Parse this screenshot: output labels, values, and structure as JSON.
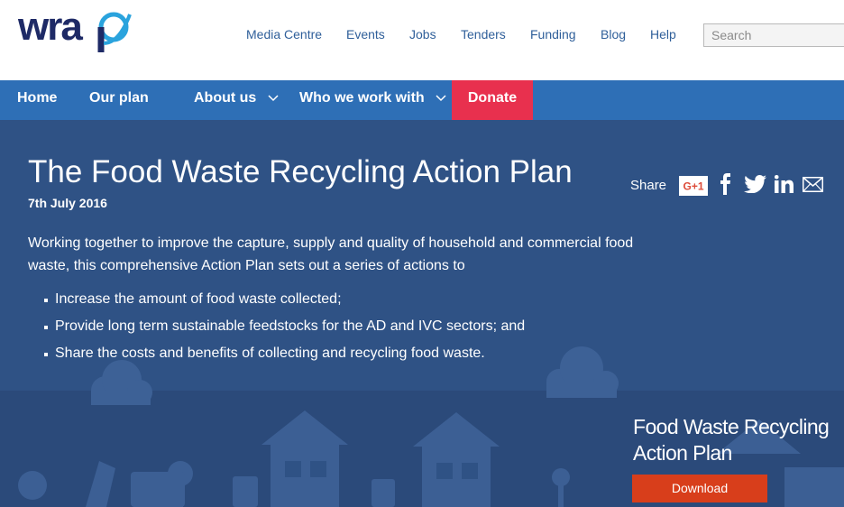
{
  "header": {
    "logo_text": "wrap",
    "links": [
      "Media Centre",
      "Events",
      "Jobs",
      "Tenders",
      "Funding",
      "Blog",
      "Help"
    ],
    "search_placeholder": "Search"
  },
  "nav": {
    "items": [
      "Home",
      "Our plan",
      "About us",
      "Who we work with",
      "Donate"
    ]
  },
  "hero": {
    "title": "The Food Waste Recycling Action Plan",
    "date": "7th July 2016",
    "intro": "Working together to improve the capture, supply and quality of household and commercial food waste, this comprehensive Action Plan sets out a series of actions to",
    "bullets": [
      "Increase the amount of food waste collected;",
      "Provide long term sustainable feedstocks for the AD and IVC sectors; and",
      "Share the costs and benefits of collecting and recycling food waste."
    ],
    "share_label": "Share",
    "share_icons": [
      "google-plus-icon",
      "facebook-icon",
      "twitter-icon",
      "linkedin-icon",
      "email-icon"
    ],
    "gplus_text": "G+1",
    "promo_title": "Food Waste Recycling Action Plan",
    "download_label": "Download"
  },
  "colors": {
    "brand_blue": "#1e2a66",
    "nav_blue": "#2e6fb6",
    "donate_red": "#e8304e",
    "hero_blue": "#2f5285",
    "download_red": "#d83e1b"
  }
}
